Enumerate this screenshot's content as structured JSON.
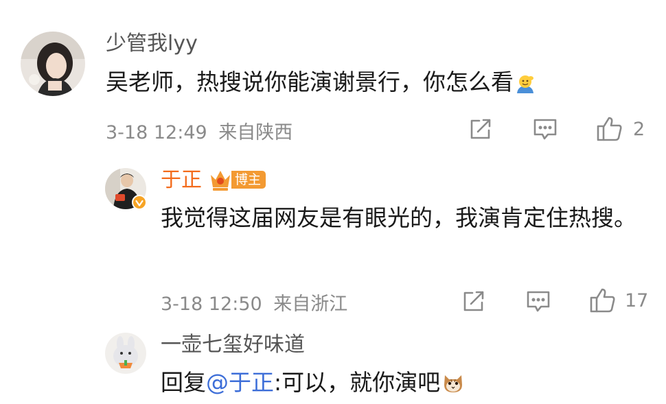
{
  "comments": [
    {
      "username": "少管我lyy",
      "text": "吴老师，热搜说你能演谢景行，你怎么看",
      "emoji": "salute-emoji",
      "time": "3-18 12:49",
      "location": "来自陕西",
      "likes": "2"
    },
    {
      "username": "于正",
      "badge": "博主",
      "text": "我觉得这届网友是有眼光的，我演肯定住热搜。",
      "time": "3-18 12:50",
      "location": "来自浙江",
      "likes": "17"
    },
    {
      "username": "一壶七玺好味道",
      "reply_prefix": "回复",
      "mention": "@于正",
      "text": ":可以，就你演吧",
      "emoji": "cat-emoji"
    }
  ],
  "colors": {
    "username_gray": "#555555",
    "username_vip": "#f36b1c",
    "badge": "#f39a32",
    "meta": "#8a8a8a",
    "mention": "#3d6ed8"
  },
  "icons": [
    "share-icon",
    "comment-icon",
    "like-icon",
    "crown-icon",
    "verified-icon"
  ]
}
